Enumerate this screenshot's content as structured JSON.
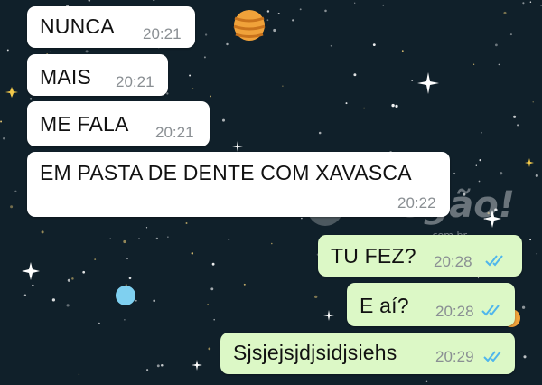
{
  "colors": {
    "wallpaper": "#10202a",
    "incoming_bubble": "#ffffff",
    "outgoing_bubble": "#dcf8c6",
    "timestamp": "#8a8f93",
    "read_ticks": "#4fb6ec"
  },
  "messages": [
    {
      "direction": "incoming",
      "text": "NUNCA",
      "time": "20:21"
    },
    {
      "direction": "incoming",
      "text": "MAIS",
      "time": "20:21"
    },
    {
      "direction": "incoming",
      "text": "ME FALA",
      "time": "20:21"
    },
    {
      "direction": "incoming",
      "text": "EM PASTA DE DENTE COM XAVASCA",
      "time": "20:22"
    },
    {
      "direction": "outgoing",
      "text": "TU FEZ?",
      "time": "20:28",
      "status_icon": "double-check-read-icon"
    },
    {
      "direction": "outgoing",
      "text": "E aí?",
      "time": "20:28",
      "status_icon": "double-check-read-icon"
    },
    {
      "direction": "outgoing",
      "text": "Sjsjejsjdjsidjsiehs",
      "time": "20:29",
      "status_icon": "double-check-read-icon"
    }
  ],
  "watermark": {
    "text": "Negão!",
    "sub": ".com.br"
  }
}
